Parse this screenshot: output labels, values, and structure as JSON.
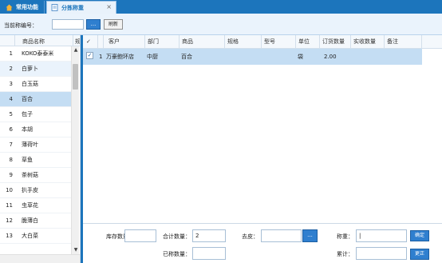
{
  "tabs": [
    {
      "label": "常用功能",
      "icon": "home-icon"
    },
    {
      "label": "分拣称重",
      "icon": "document-icon",
      "close": "×"
    }
  ],
  "toolbar": {
    "label": "当前称编号：",
    "input_value": "",
    "dots_label": "...",
    "refresh_label": "刷新"
  },
  "left_list": {
    "headers": {
      "name": "商品名称",
      "extra": "规"
    },
    "rows": [
      {
        "num": "1",
        "name": "KOKO泰泰米"
      },
      {
        "num": "2",
        "name": "白萝卜"
      },
      {
        "num": "3",
        "name": "白玉菇"
      },
      {
        "num": "4",
        "name": "百合"
      },
      {
        "num": "5",
        "name": "包子"
      },
      {
        "num": "6",
        "name": "本胡"
      },
      {
        "num": "7",
        "name": "薄荷叶"
      },
      {
        "num": "8",
        "name": "草鱼"
      },
      {
        "num": "9",
        "name": "茶树菇"
      },
      {
        "num": "10",
        "name": "扒手皮"
      },
      {
        "num": "11",
        "name": "虫草花"
      },
      {
        "num": "12",
        "name": "脆薄白"
      },
      {
        "num": "13",
        "name": "大白菜"
      }
    ],
    "selected_index": 3,
    "hover_index": 1,
    "scroll_up": "▲",
    "scroll_down": "▼"
  },
  "grid": {
    "check_header": "✓",
    "headers": {
      "customer": "客户",
      "dept": "部门",
      "product": "商品",
      "spec": "规格",
      "model": "型号",
      "unit": "单位",
      "order_qty": "订货数量",
      "actual_qty": "实收数量",
      "remark": "备注"
    },
    "rows": [
      {
        "checked": "✓",
        "num": "1",
        "customer": "万豪鲍环店",
        "dept": "中厨",
        "product": "百合",
        "spec": "",
        "model": "",
        "unit": "袋",
        "order_qty": "2.00",
        "actual_qty": "",
        "remark": ""
      }
    ]
  },
  "form": {
    "stock_label": "库存数量：",
    "stock_value": "",
    "total_label": "合计数量：",
    "total_value": "2",
    "weighed_label": "已称数量：",
    "weighed_value": "",
    "tare_label": "去皮：",
    "tare_value": "",
    "tare_dots": "...",
    "weight_label": "称重：",
    "weight_value": "|",
    "confirm_label": "确定",
    "cumulative_label": "累计：",
    "cumulative_value": "",
    "correct_label": "更正"
  },
  "colors": {
    "accent": "#1c75bc",
    "selected_row": "#c4ddf3",
    "button_blue": "#2f7fcf"
  }
}
